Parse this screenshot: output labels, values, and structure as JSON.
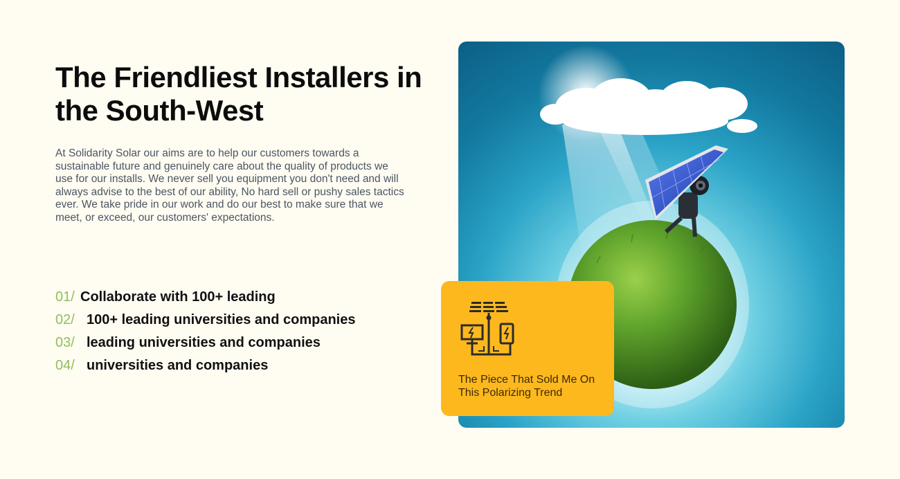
{
  "heading": "The Friendliest Installers in the South-West",
  "description": "At Solidarity Solar our aims are to help our customers towards a sustainable future and genuinely care about the quality of products we use for our installs. We never sell you equipment you don't need and will always advise to the best of our ability, No hard sell or pushy sales tactics ever. We take pride in our work and do our best to make sure that we meet, or exceed, our customers' expectations.",
  "features": [
    {
      "num": "01/",
      "text": "Collaborate with 100+ leading"
    },
    {
      "num": "02/",
      "text": "100+ leading universities and companies"
    },
    {
      "num": "03/",
      "text": "leading universities and companies"
    },
    {
      "num": "04/",
      "text": "universities and companies"
    }
  ],
  "card": {
    "icon": "solar-energy-system-icon",
    "text": "The Piece That Sold Me On This Polarizing Trend"
  },
  "hero_image": "robot-carrying-solar-panel-on-green-planet-under-cloud",
  "colors": {
    "background": "#fffcf2",
    "accent_number": "#8fbf5a",
    "card": "#fdb81e",
    "hero_blue": "#137aa0"
  }
}
